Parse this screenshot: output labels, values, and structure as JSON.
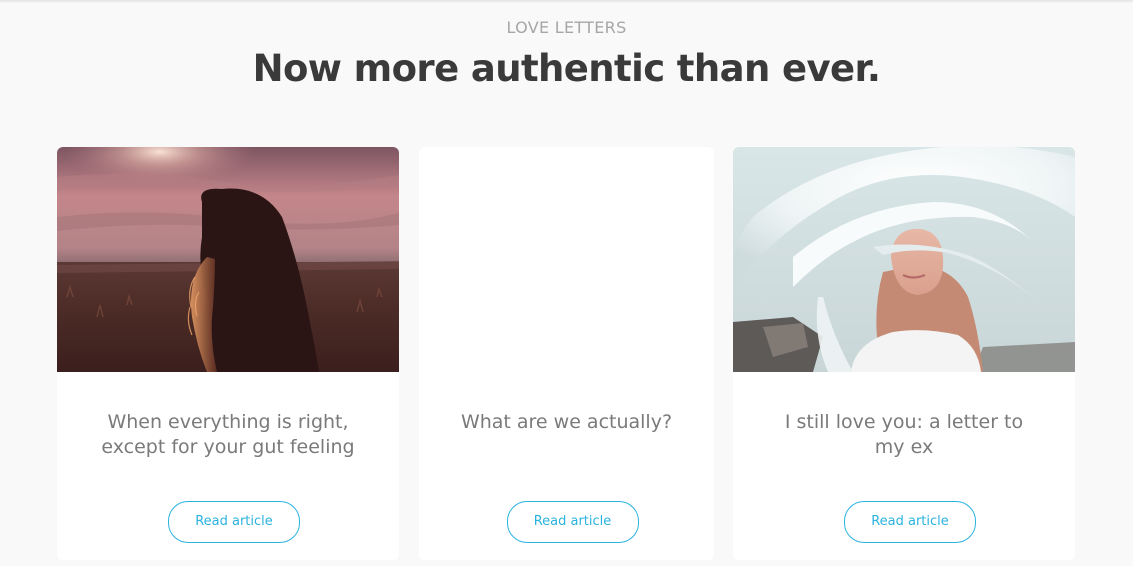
{
  "section": {
    "eyebrow": "LOVE LETTERS",
    "headline": "Now more authentic than ever."
  },
  "cards": [
    {
      "title": "When everything is right, except for your gut feeling",
      "button_label": "Read article",
      "image": "woman-sunset-field-photo"
    },
    {
      "title": "What are we actually?",
      "button_label": "Read article",
      "image": "blank"
    },
    {
      "title": "I still love you: a letter to my ex",
      "button_label": "Read article",
      "image": "woman-under-white-sheet-photo"
    }
  ],
  "colors": {
    "background": "#f9f9f9",
    "card": "#ffffff",
    "headline": "#3a3a3a",
    "eyebrow": "#a6a6a6",
    "title": "#7a7a7a",
    "accent": "#2bb3df"
  }
}
